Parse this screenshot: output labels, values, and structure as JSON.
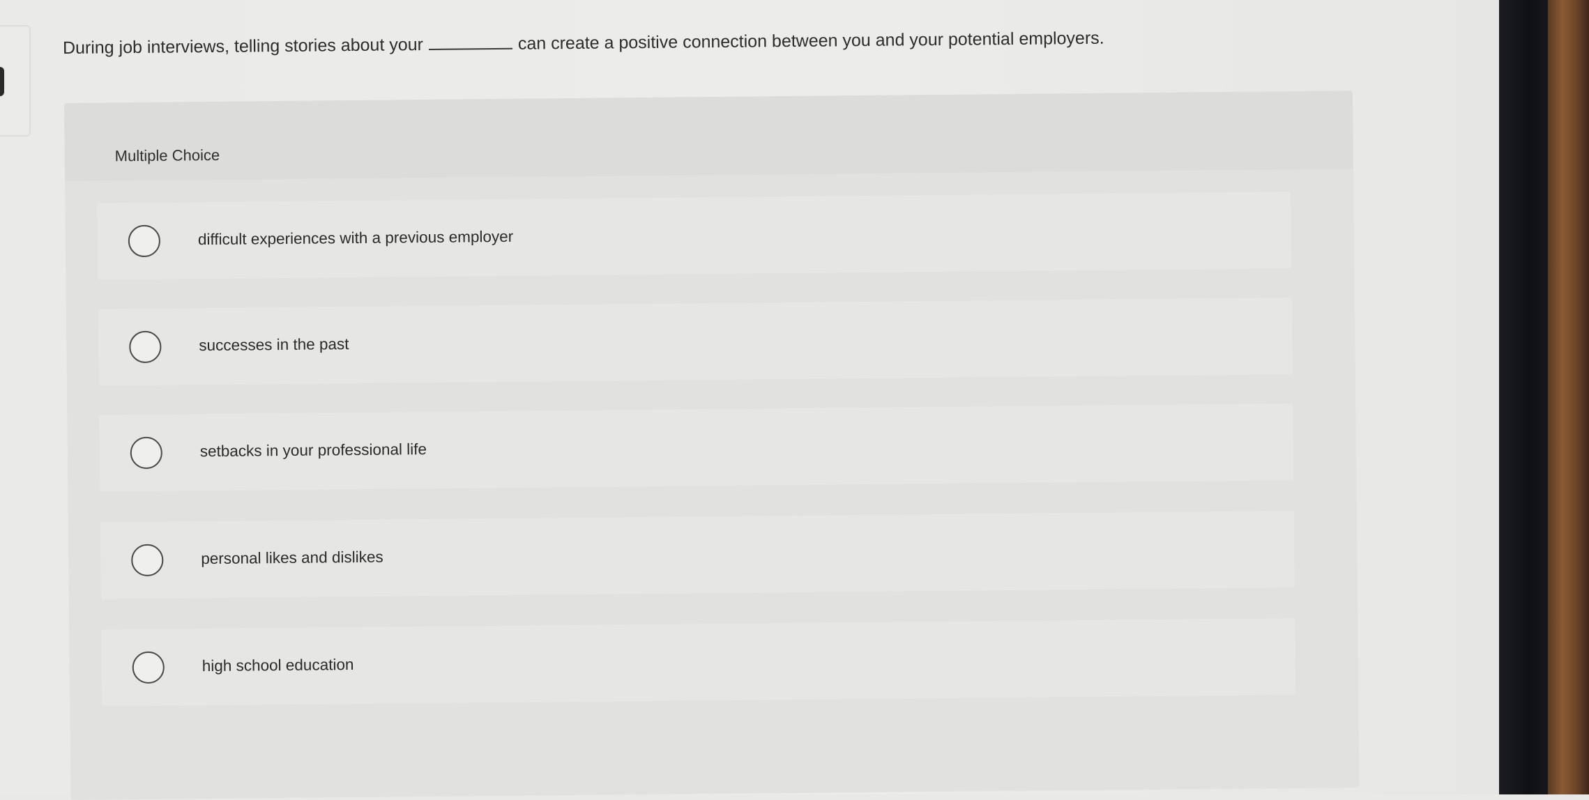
{
  "question": {
    "before_blank": "During job interviews, telling stories about your",
    "after_blank": "can create a positive connection between you and your potential employers."
  },
  "question_type": "Multiple Choice",
  "choices": [
    {
      "label": "difficult experiences with a previous employer"
    },
    {
      "label": "successes in the past"
    },
    {
      "label": "setbacks in your professional life"
    },
    {
      "label": "personal likes and dislikes"
    },
    {
      "label": "high school education"
    }
  ]
}
